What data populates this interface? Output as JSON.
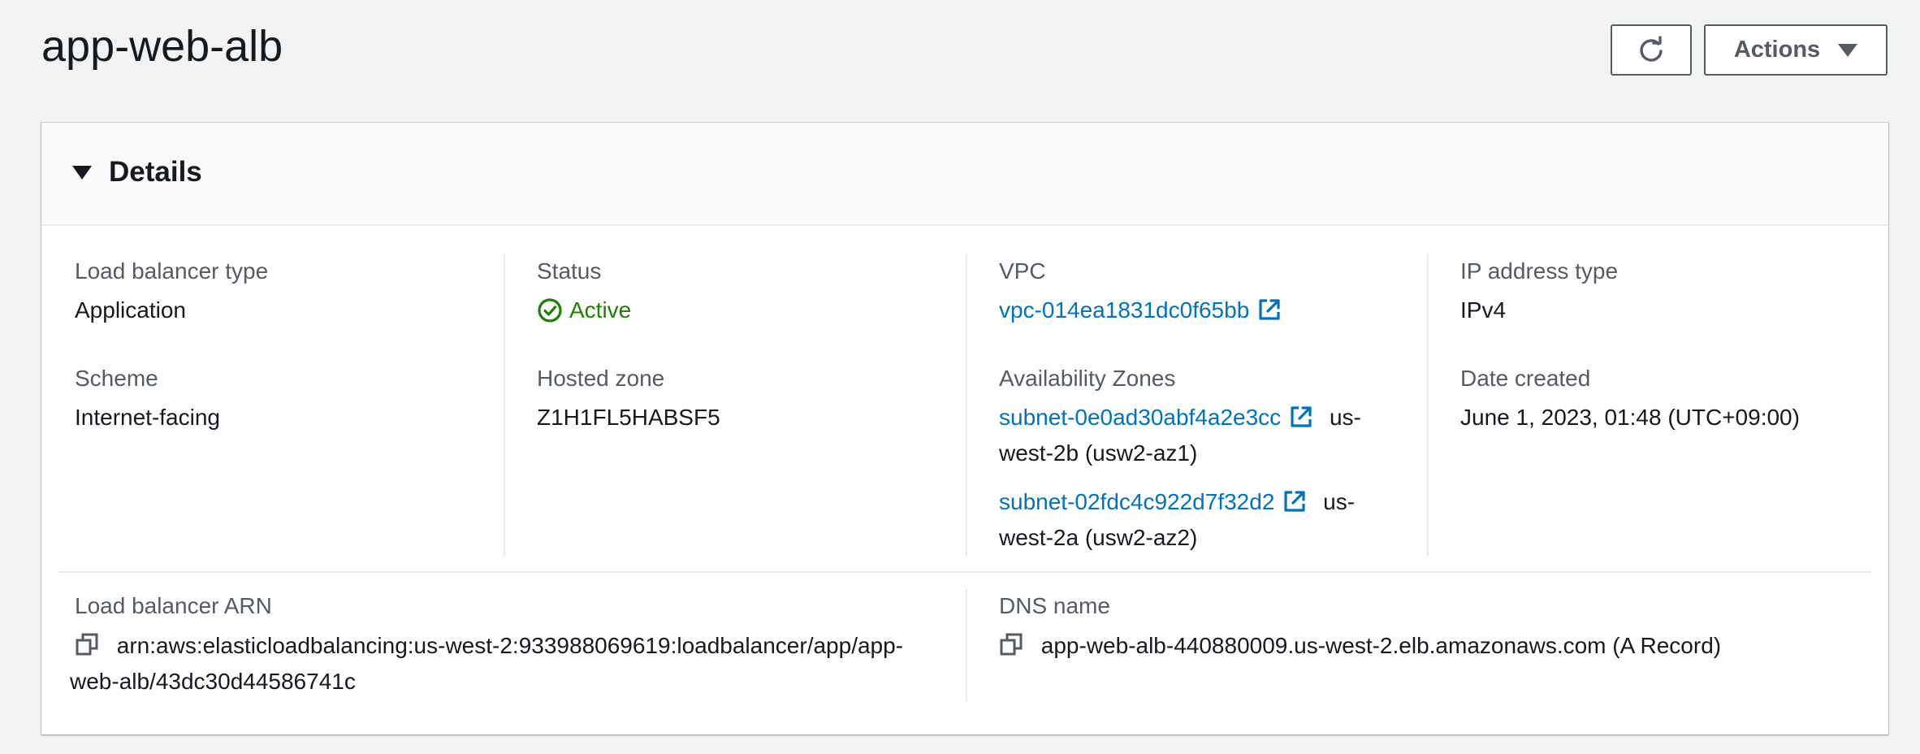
{
  "page": {
    "title": "app-web-alb"
  },
  "header_actions": {
    "actions_label": "Actions",
    "refresh_icon": "refresh-icon"
  },
  "details": {
    "title": "Details",
    "lb_type": {
      "label": "Load balancer type",
      "value": "Application"
    },
    "status": {
      "label": "Status",
      "value": "Active",
      "color": "#1d8102"
    },
    "vpc": {
      "label": "VPC",
      "value": "vpc-014ea1831dc0f65bb"
    },
    "ip_type": {
      "label": "IP address type",
      "value": "IPv4"
    },
    "scheme": {
      "label": "Scheme",
      "value": "Internet-facing"
    },
    "hosted_zone": {
      "label": "Hosted zone",
      "value": "Z1H1FL5HABSF5"
    },
    "azs": {
      "label": "Availability Zones",
      "items": [
        {
          "subnet": "subnet-0e0ad30abf4a2e3cc",
          "zone_line1": "us-",
          "zone_line2": "west-2b (usw2-az1)"
        },
        {
          "subnet": "subnet-02fdc4c922d7f32d2",
          "zone_line1": "us-",
          "zone_line2": "west-2a (usw2-az2)"
        }
      ]
    },
    "date_created": {
      "label": "Date created",
      "value": "June 1, 2023, 01:48 (UTC+09:00)"
    },
    "arn": {
      "label": "Load balancer ARN",
      "line1": "arn:aws:elasticloadbalancing:us-west-2:933988069619:loadbalancer/app/app-",
      "line2": "web-alb/43dc30d44586741c"
    },
    "dns": {
      "label": "DNS name",
      "value": "app-web-alb-440880009.us-west-2.elb.amazonaws.com (A Record)"
    }
  },
  "colors": {
    "link": "#0073bb",
    "success": "#1d8102",
    "text": "#16191f",
    "label": "#545b64"
  }
}
